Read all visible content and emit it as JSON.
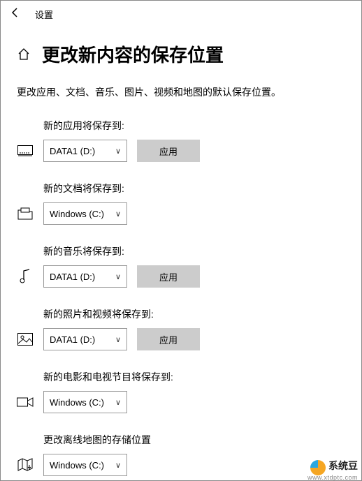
{
  "header": {
    "title": "设置"
  },
  "page": {
    "title": "更改新内容的保存位置",
    "description": "更改应用、文档、音乐、图片、视频和地图的默认保存位置。"
  },
  "buttons": {
    "apply": "应用"
  },
  "drives": {
    "data1": "DATA1 (D:)",
    "windows": "Windows (C:)"
  },
  "groups": {
    "apps": {
      "label": "新的应用将保存到:",
      "selected": "DATA1 (D:)",
      "has_apply": true
    },
    "docs": {
      "label": "新的文档将保存到:",
      "selected": "Windows (C:)",
      "has_apply": false
    },
    "music": {
      "label": "新的音乐将保存到:",
      "selected": "DATA1 (D:)",
      "has_apply": true
    },
    "photos": {
      "label": "新的照片和视频将保存到:",
      "selected": "DATA1 (D:)",
      "has_apply": true
    },
    "movies": {
      "label": "新的电影和电视节目将保存到:",
      "selected": "Windows (C:)",
      "has_apply": false
    },
    "maps": {
      "label": "更改离线地图的存储位置",
      "selected": "Windows (C:)",
      "has_apply": false
    }
  },
  "watermark": {
    "text": "系统豆",
    "sub": "www.xtdptc.com"
  }
}
